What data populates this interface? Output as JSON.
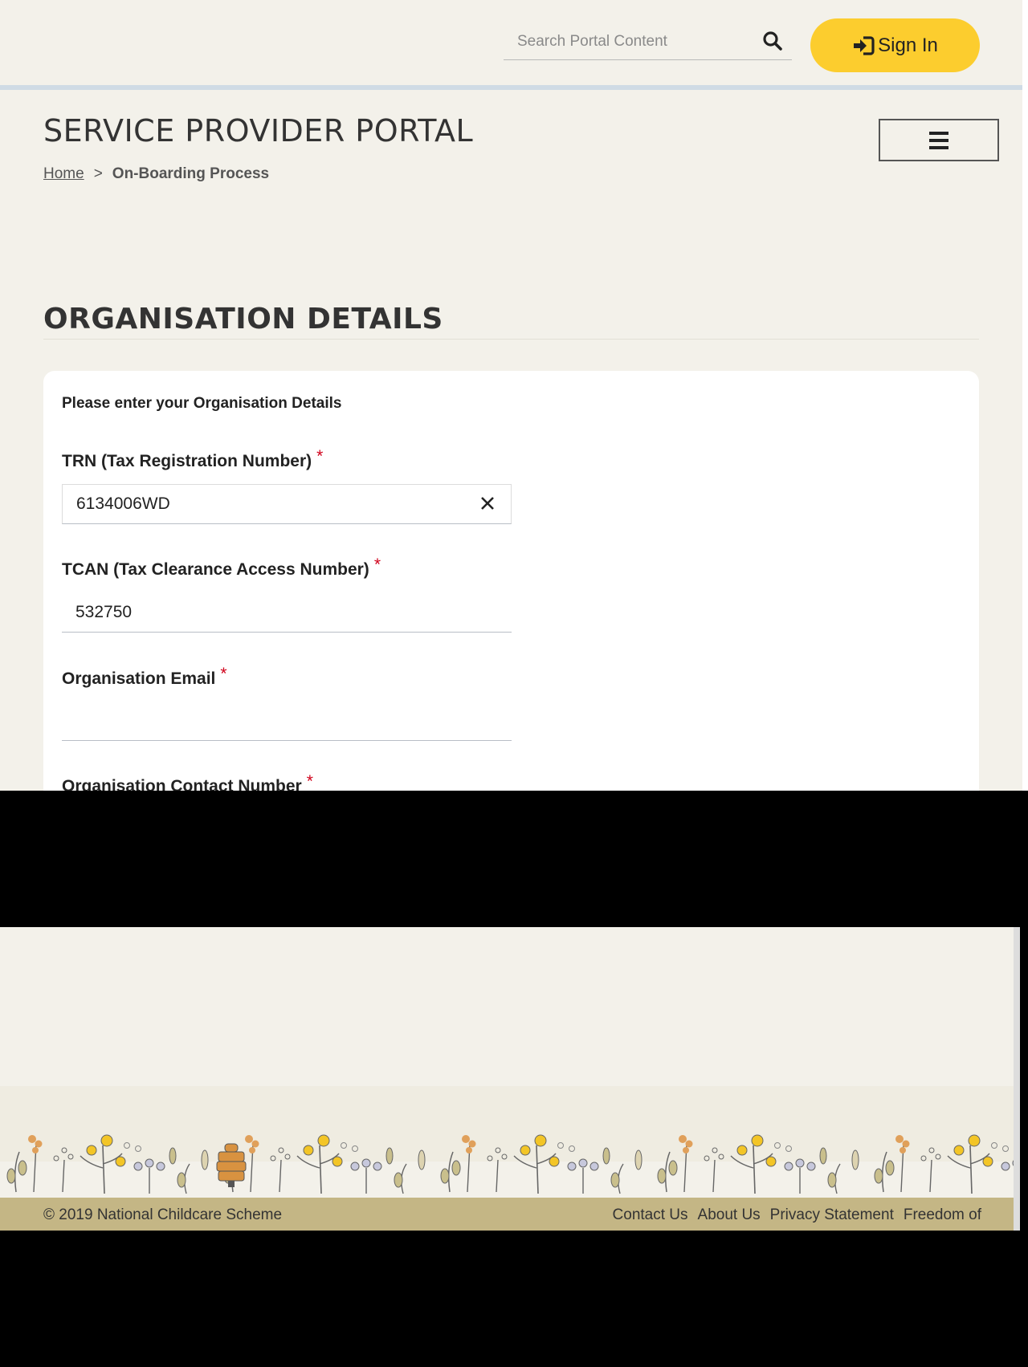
{
  "header": {
    "search_placeholder": "Search Portal Content",
    "signin_label": "Sign In",
    "accent_color": "#fccd2e"
  },
  "portal": {
    "title": "SERVICE PROVIDER PORTAL"
  },
  "breadcrumb": {
    "home": "Home",
    "separator": ">",
    "current": "On-Boarding Process"
  },
  "section": {
    "title": "ORGANISATION DETAILS"
  },
  "form": {
    "intro": "Please enter your Organisation Details",
    "fields": [
      {
        "label": "TRN (Tax Registration Number)",
        "required": "*",
        "value": "6134006WD"
      },
      {
        "label": "TCAN (Tax Clearance Access Number)",
        "required": "*",
        "value": "532750"
      },
      {
        "label": "Organisation Email",
        "required": "*",
        "value": ""
      },
      {
        "label": "Organisation Contact Number",
        "required": "*"
      }
    ],
    "required_color": "#d0021b"
  },
  "footer": {
    "copyright": "© 2019 National Childcare Scheme",
    "links": [
      "Contact Us",
      "About Us",
      "Privacy Statement",
      "Freedom of"
    ]
  },
  "icons": {
    "search": "search-icon",
    "signin": "sign-in-icon",
    "menu": "hamburger-menu-icon",
    "clear": "close-icon",
    "footer_art": "flower-border-illustration"
  }
}
